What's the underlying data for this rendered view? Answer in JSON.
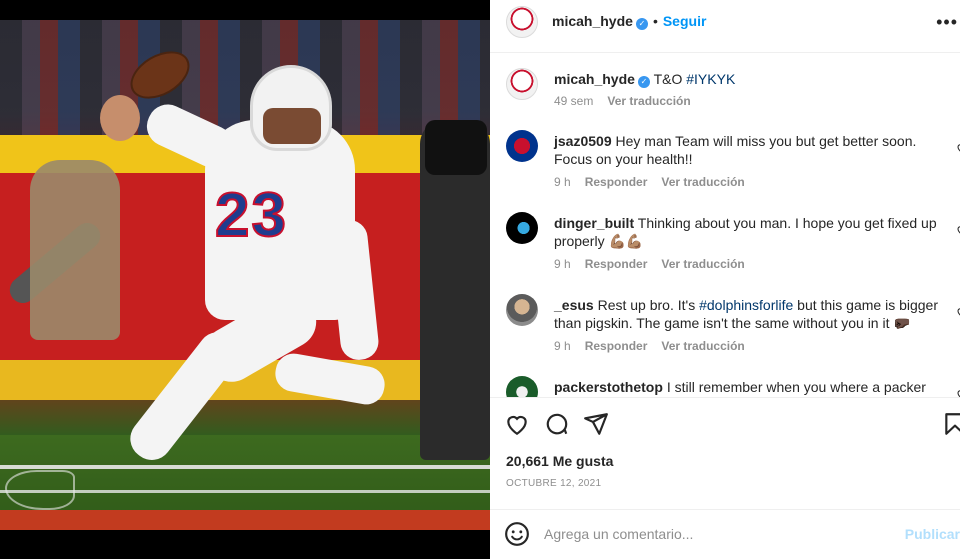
{
  "post": {
    "author": "micah_hyde",
    "follow_label": "Seguir",
    "more_label": "•••",
    "caption_text": "T&O ",
    "caption_tag": "#IYKYK",
    "caption_time": "49 sem",
    "caption_translate": "Ver traducción"
  },
  "comments": [
    {
      "user": "jsaz0509",
      "text": "Hey man Team will miss you but get better soon. Focus on your health!!",
      "time": "9 h",
      "reply": "Responder",
      "translate": "Ver traducción"
    },
    {
      "user": "dinger_built",
      "text": "Thinking about you man. I hope you get fixed up properly 💪🏽💪🏽",
      "time": "9 h",
      "reply": "Responder",
      "translate": "Ver traducción"
    },
    {
      "user": "_esus",
      "text_before": "Rest up bro. It's ",
      "tag": "#dolphinsforlife",
      "text_after": " but this game is bigger than pigskin. The game isn't the same without you in it 🤛🏿",
      "time": "9 h",
      "reply": "Responder",
      "translate": "Ver traducción"
    },
    {
      "user": "packerstothetop",
      "text": "I still remember when you where a packer"
    }
  ],
  "likes": "20,661 Me gusta",
  "date": "OCTUBRE 12, 2021",
  "add_comment": {
    "placeholder": "Agrega un comentario...",
    "publish_label": "Publicar"
  },
  "photo": {
    "jersey_number": "23"
  },
  "colors": {
    "accent": "#0095f6",
    "verified": "#3897f0",
    "tag": "#00376b",
    "muted": "#8e8e8e"
  },
  "icons": [
    "heart-icon",
    "comment-icon",
    "share-icon",
    "bookmark-icon",
    "emoji-icon",
    "verified-icon",
    "more-icon"
  ]
}
